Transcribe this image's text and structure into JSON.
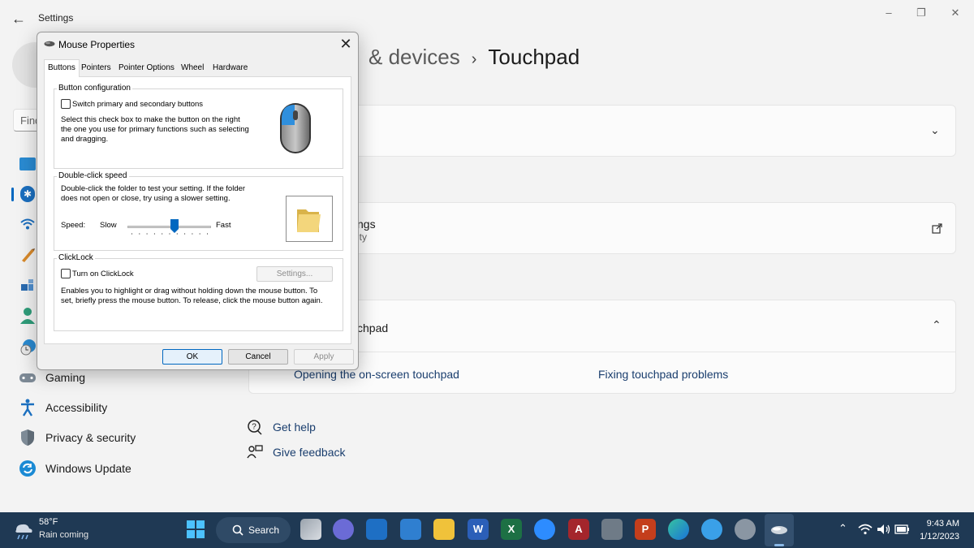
{
  "settings": {
    "app_title": "Settings",
    "search_placeholder": "Find",
    "breadcrumb": {
      "parent": "& devices",
      "current": "Touchpad"
    },
    "nav": [
      {
        "label": "Gaming",
        "icon": "gaming-icon"
      },
      {
        "label": "Accessibility",
        "icon": "accessibility-icon"
      },
      {
        "label": "Privacy & security",
        "icon": "shield-icon"
      },
      {
        "label": "Windows Update",
        "icon": "update-icon"
      }
    ],
    "card2": {
      "title_fragment": "ngs",
      "subtitle_fragment": "ity"
    },
    "card3": {
      "title_fragment": "chpad"
    },
    "links": {
      "opening": "Opening the on-screen touchpad",
      "fixing": "Fixing touchpad problems"
    },
    "help": {
      "get_help": "Get help",
      "give_feedback": "Give feedback"
    }
  },
  "dialog": {
    "title": "Mouse Properties",
    "tabs": [
      "Buttons",
      "Pointers",
      "Pointer Options",
      "Wheel",
      "Hardware"
    ],
    "active_tab": "Buttons",
    "button_config": {
      "group_label": "Button configuration",
      "checkbox_label": "Switch primary and secondary buttons",
      "checked": false,
      "description": "Select this check box to make the button on the right the one you use for primary functions such as selecting and dragging."
    },
    "double_click": {
      "group_label": "Double-click speed",
      "description": "Double-click the folder to test your setting. If the folder does not open or close, try using a slower setting.",
      "speed_label": "Speed:",
      "slow_label": "Slow",
      "fast_label": "Fast",
      "slider_value": 0.57
    },
    "clicklock": {
      "group_label": "ClickLock",
      "checkbox_label": "Turn on ClickLock",
      "checked": false,
      "settings_button": "Settings...",
      "description": "Enables you to highlight or drag without holding down the mouse button. To set, briefly press the mouse button. To release, click the mouse button again."
    },
    "buttons": {
      "ok": "OK",
      "cancel": "Cancel",
      "apply": "Apply"
    }
  },
  "taskbar": {
    "weather_temp": "58°F",
    "weather_desc": "Rain coming",
    "search_label": "Search",
    "time": "9:43 AM",
    "date": "1/12/2023"
  },
  "colors": {
    "accent": "#0067c0",
    "taskbar": "#1f3954",
    "link": "#1a3e6e"
  }
}
